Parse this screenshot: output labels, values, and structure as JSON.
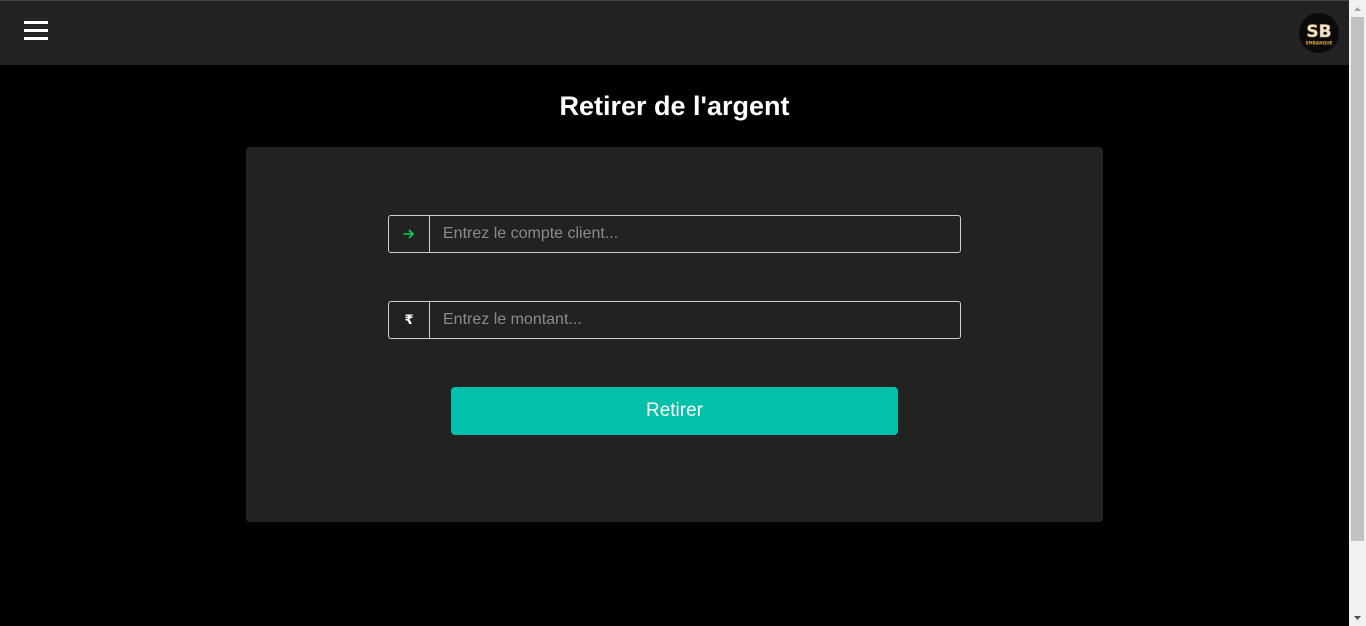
{
  "navbar": {
    "menu_icon": "hamburger-menu-icon",
    "logo_letters": "SB",
    "logo_tagline": "SMBANQUE"
  },
  "page": {
    "title": "Retirer de l'argent"
  },
  "form": {
    "account": {
      "icon": "arrow-right-icon",
      "placeholder": "Entrez le compte client...",
      "value": ""
    },
    "amount": {
      "icon_glyph": "₹",
      "placeholder": "Entrez le montant...",
      "value": ""
    },
    "submit_label": "Retirer"
  },
  "colors": {
    "background": "#000000",
    "navbar": "#222222",
    "card": "#222222",
    "accent": "#02c1ab",
    "arrow_icon": "#00d45a",
    "logo_gold": "#d9a441"
  }
}
